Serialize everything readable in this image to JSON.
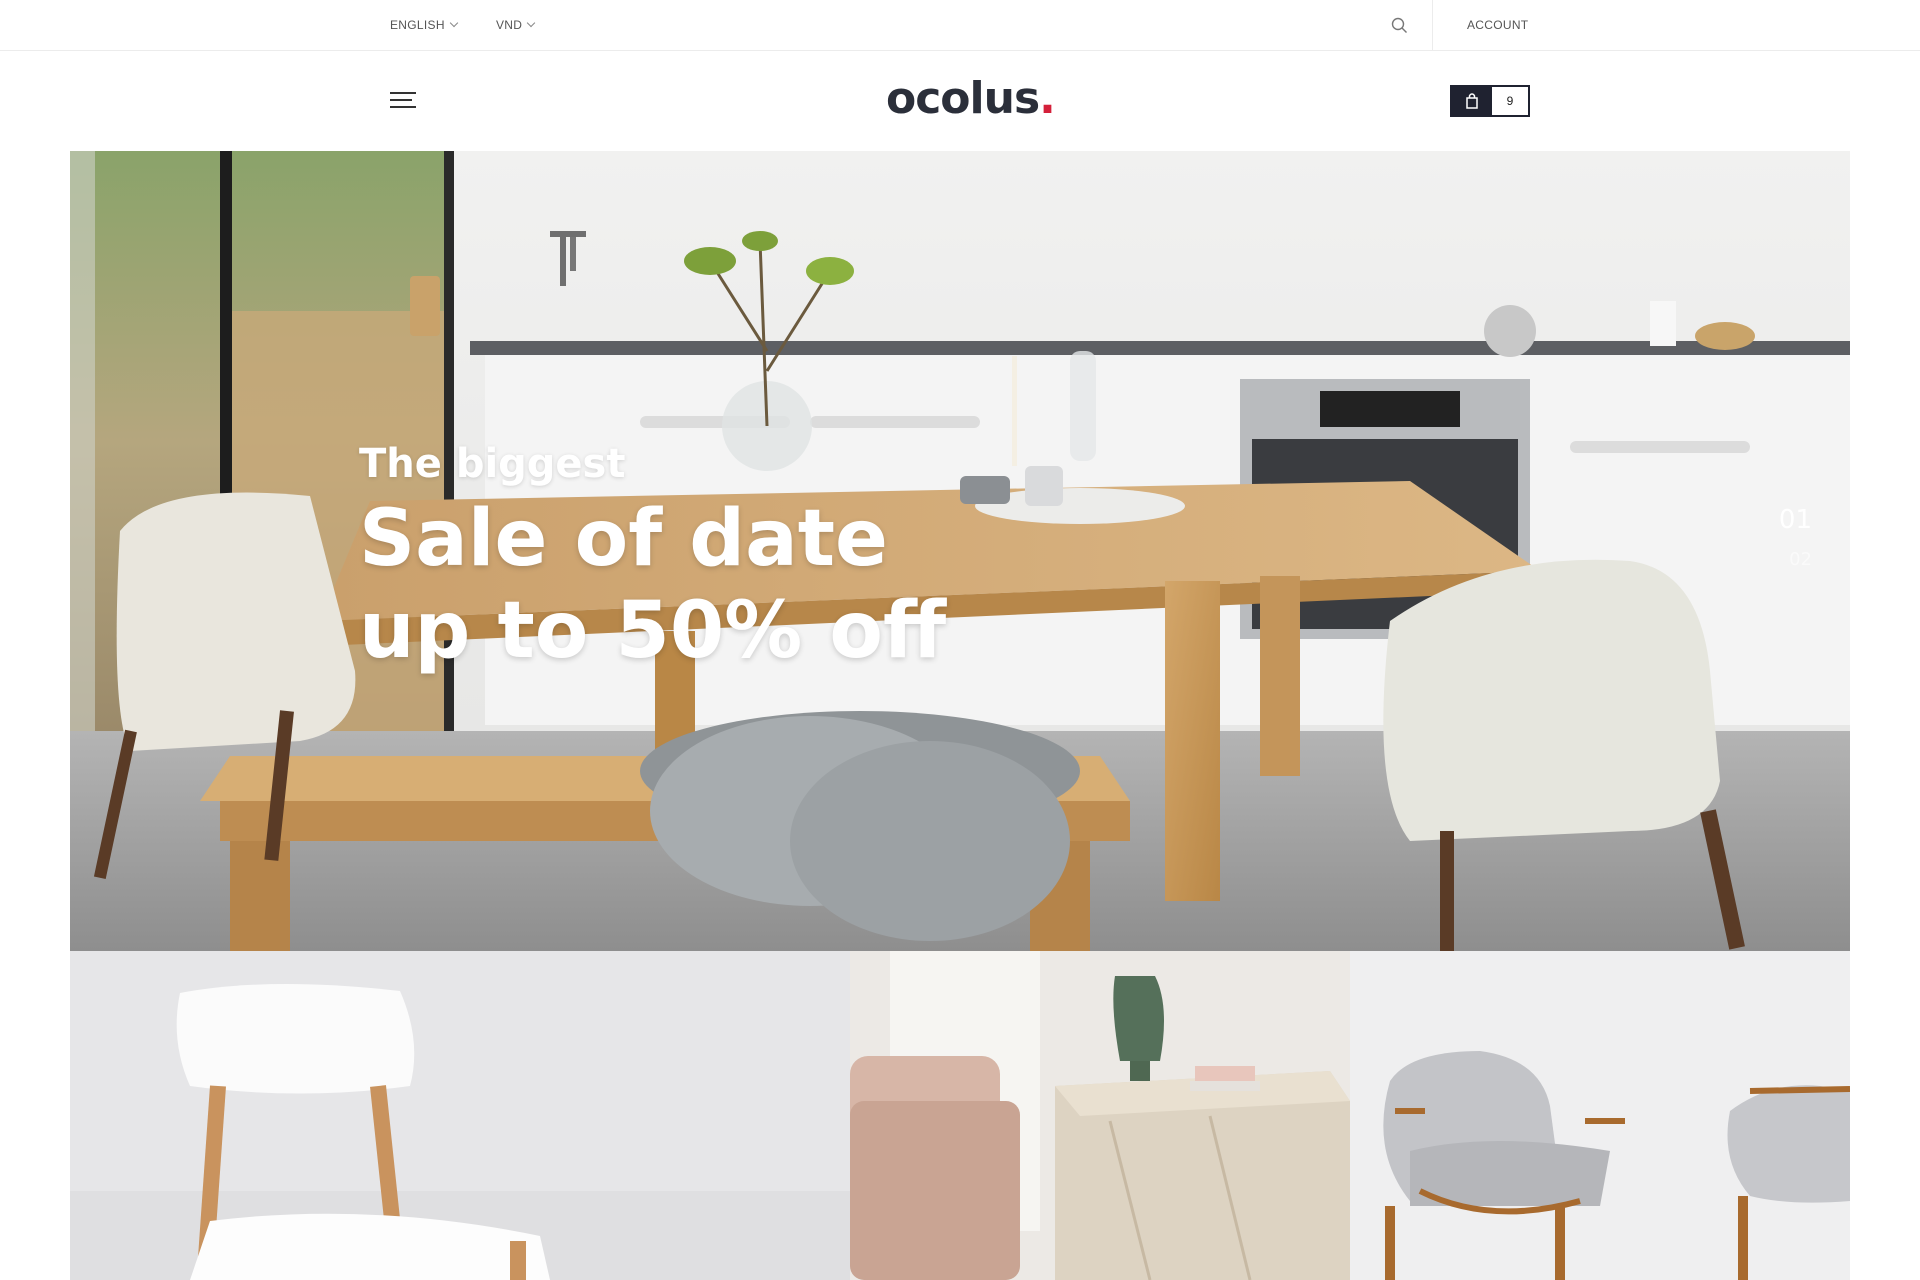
{
  "topbar": {
    "language": "ENGLISH",
    "currency": "VND",
    "account_label": "ACCOUNT"
  },
  "header": {
    "logo_text": "ocolus",
    "logo_dot": ".",
    "cart_count": "9"
  },
  "hero": {
    "pretitle": "The biggest",
    "title_line1": "Sale of date",
    "title_line2": "up to 50% off",
    "slides": [
      "01",
      "02"
    ]
  },
  "colors": {
    "brand_dark": "#2b2f3a",
    "brand_accent": "#d4203a",
    "cart_dark": "#1f2230"
  },
  "icons": [
    "chevron-down-icon",
    "search-icon",
    "hamburger-menu-icon",
    "shopping-bag-icon"
  ]
}
